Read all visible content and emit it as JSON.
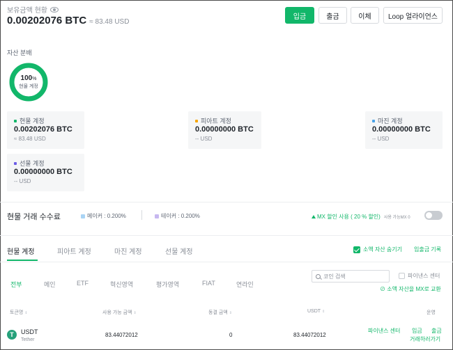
{
  "header": {
    "balance_label": "보유금액 현황",
    "balance_btc": "0.00202076 BTC",
    "balance_usd": "≈ 83.48 USD",
    "buttons": {
      "deposit": "입금",
      "withdraw": "출금",
      "transfer": "이체",
      "loop": "Loop 얼라이언스"
    }
  },
  "distribution": {
    "label": "자산 분배",
    "donut_percent": "100",
    "donut_percent_unit": "%",
    "donut_label": "현물 계정",
    "fill_fraction": 1.0,
    "color": "#12b76a"
  },
  "accounts": [
    {
      "name": "현물 계정",
      "value": "0.00202076 BTC",
      "sub": "≈ 83.48 USD",
      "color": "#12b76a"
    },
    {
      "name": "피아트 계정",
      "value": "0.00000000 BTC",
      "sub": "-- USD",
      "color": "#f7a600"
    },
    {
      "name": "마진 계정",
      "value": "0.00000000 BTC",
      "sub": "-- USD",
      "color": "#4aa3e8"
    },
    {
      "name": "선물 계정",
      "value": "0.00000000 BTC",
      "sub": "-- USD",
      "color": "#6c5ce7"
    }
  ],
  "fees": {
    "title": "현물 거래 수수료",
    "maker": "메이커 : 0.200%",
    "taker": "테이커 : 0.200%",
    "mx_discount": "MX 할인 사용 ( 20 % 할인)",
    "mx_available": "사용 가능MX 0",
    "mx_enabled": false
  },
  "tabs": [
    "현물 계정",
    "피아트 계정",
    "마진 계정",
    "선물 계정"
  ],
  "active_tab": "현물 계정",
  "hide_small": "소액 자산 숨기기",
  "history_link": "입출금 기록",
  "filters": [
    "전부",
    "메인",
    "ETF",
    "혁신영역",
    "평가영역",
    "FIAT",
    "연라인"
  ],
  "active_filter": "전부",
  "search_placeholder": "코인 검색",
  "binance_center": "파이낸스 센터",
  "convert_link": "소액 자산을 MX로 교환",
  "table": {
    "headers": [
      "토큰명",
      "사용 가능 금액",
      "동결 금액",
      "USDT",
      "운영"
    ],
    "rows": [
      {
        "symbol": "USDT",
        "name": "Tether",
        "logo": "T",
        "available": "83.44072012",
        "frozen": "0",
        "usdt": "83.44072012",
        "actions": [
          "파이낸스 센터",
          "입금",
          "출금",
          "거래하러가기"
        ]
      }
    ]
  }
}
